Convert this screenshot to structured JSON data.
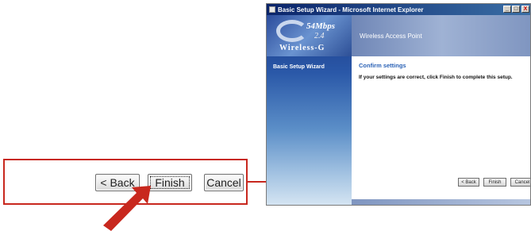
{
  "window": {
    "title": "Basic Setup Wizard - Microsoft Internet Explorer",
    "controls": {
      "minimize": "_",
      "maximize": "□",
      "close": "X"
    }
  },
  "logo": {
    "speed": "54Mbps",
    "band": "2.4",
    "name": "Wireless-G"
  },
  "sidebar": {
    "nav_item": "Basic Setup Wizard"
  },
  "header": {
    "title": "Wireless Access Point"
  },
  "main": {
    "section_title": "Confirm settings",
    "instructions": "If your settings are correct, click Finish to complete this setup."
  },
  "buttons": {
    "back": "< Back",
    "finish": "Finish",
    "cancel": "Cancel"
  },
  "colors": {
    "annotation": "#c8281e",
    "section_title": "#2b62b6",
    "titlebar": "#0a246a"
  },
  "icons": {
    "pointer": "arrow-pointer-icon",
    "app": "ie-window-icon"
  }
}
